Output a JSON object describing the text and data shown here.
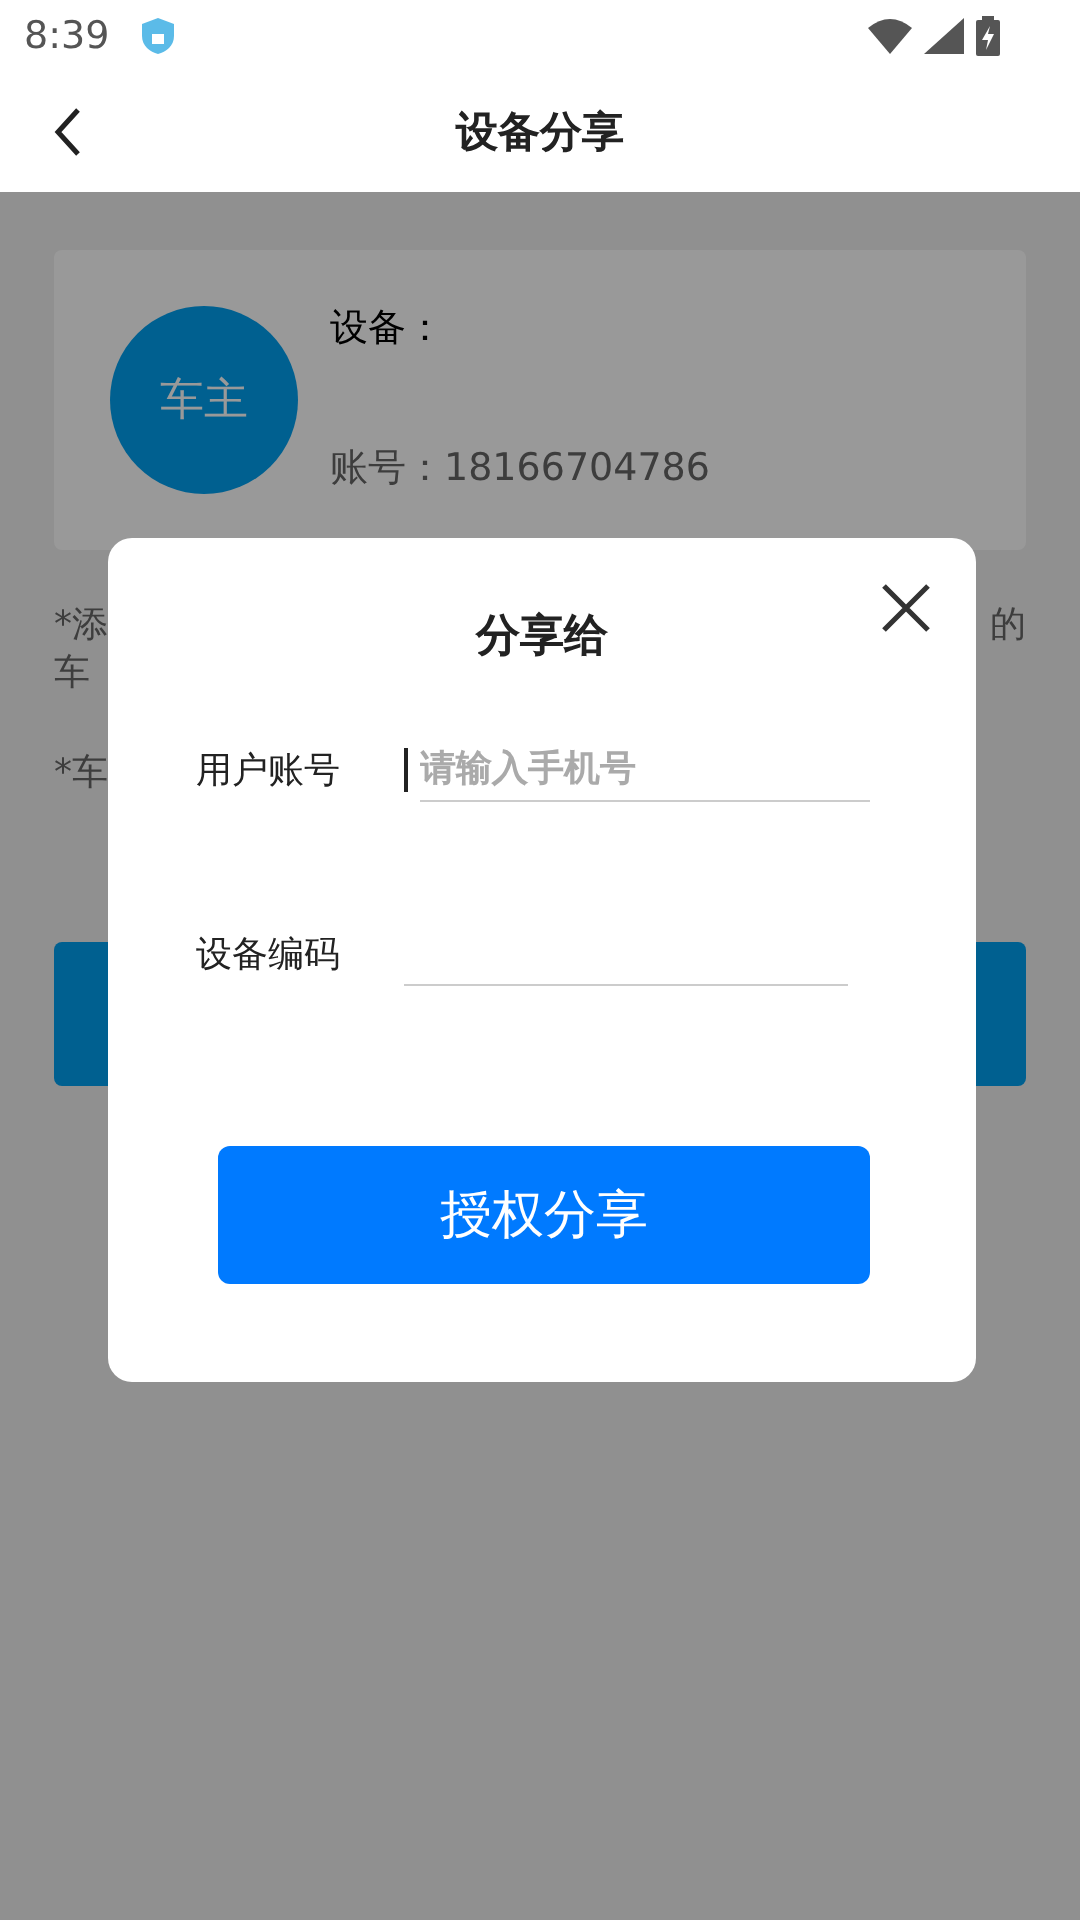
{
  "status_bar": {
    "time": "8:39"
  },
  "header": {
    "title": "设备分享"
  },
  "device_card": {
    "avatar_text": "车主",
    "device_label": "设备：",
    "account": "账号：18166704786"
  },
  "notes": [
    {
      "left": "*添",
      "right": "的"
    },
    {
      "left": "车"
    },
    {
      "left": "*车"
    }
  ],
  "dialog": {
    "title": "分享给",
    "fields": [
      {
        "label": "用户账号",
        "placeholder": "请输入手机号",
        "focused": true
      },
      {
        "label": "设备编码",
        "focused": false
      }
    ],
    "button": "授权分享"
  }
}
